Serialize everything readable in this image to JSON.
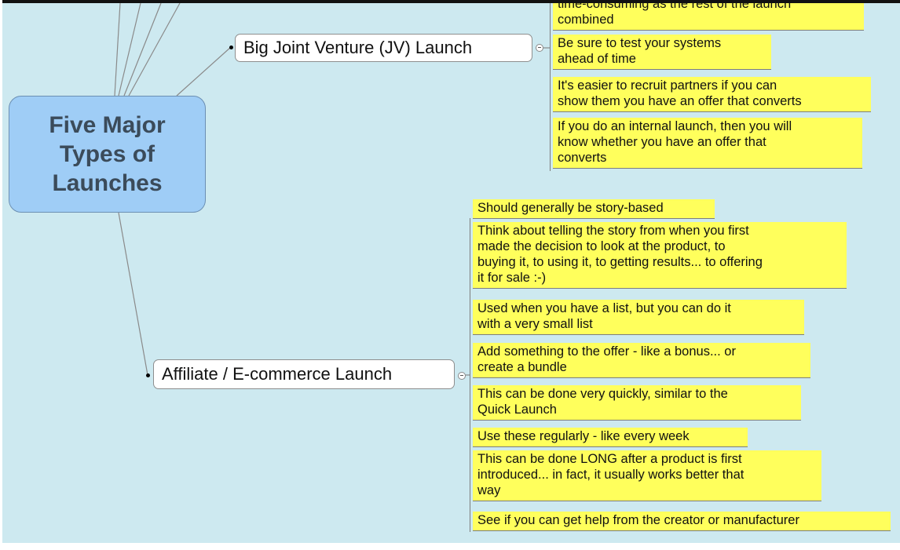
{
  "central": {
    "label": "Five Major Types of Launches"
  },
  "topics": {
    "jv": {
      "label": "Big Joint Venture (JV) Launch",
      "notes": [
        "time-consuming as the rest of the launch\ncombined",
        "Be sure to test your systems\nahead of time",
        "It's easier to recruit partners if you can\nshow them you have an offer that converts",
        "If you do an internal launch, then you will\nknow whether you have an offer that\nconverts"
      ]
    },
    "affiliate": {
      "label": "Affiliate / E-commerce Launch",
      "notes": [
        "Should generally be story-based",
        "Think about telling the story from when you first\nmade the decision to look at the product, to\nbuying it, to using it, to getting results... to offering\nit for sale    :-)",
        "Used when you have a list, but you can do it\nwith a very small list",
        "Add something to the offer - like a bonus... or\ncreate a bundle",
        "This can be done very quickly, similar to the\nQuick Launch",
        "Use these regularly - like every week",
        "This can be done LONG after a product is first\nintroduced... in fact, it usually works better that\nway",
        "See if you can get help from the creator or manufacturer"
      ]
    }
  },
  "colors": {
    "canvas": "#cde9f0",
    "central_fill": "#9fcdf6",
    "note_fill": "#ffff5c"
  }
}
